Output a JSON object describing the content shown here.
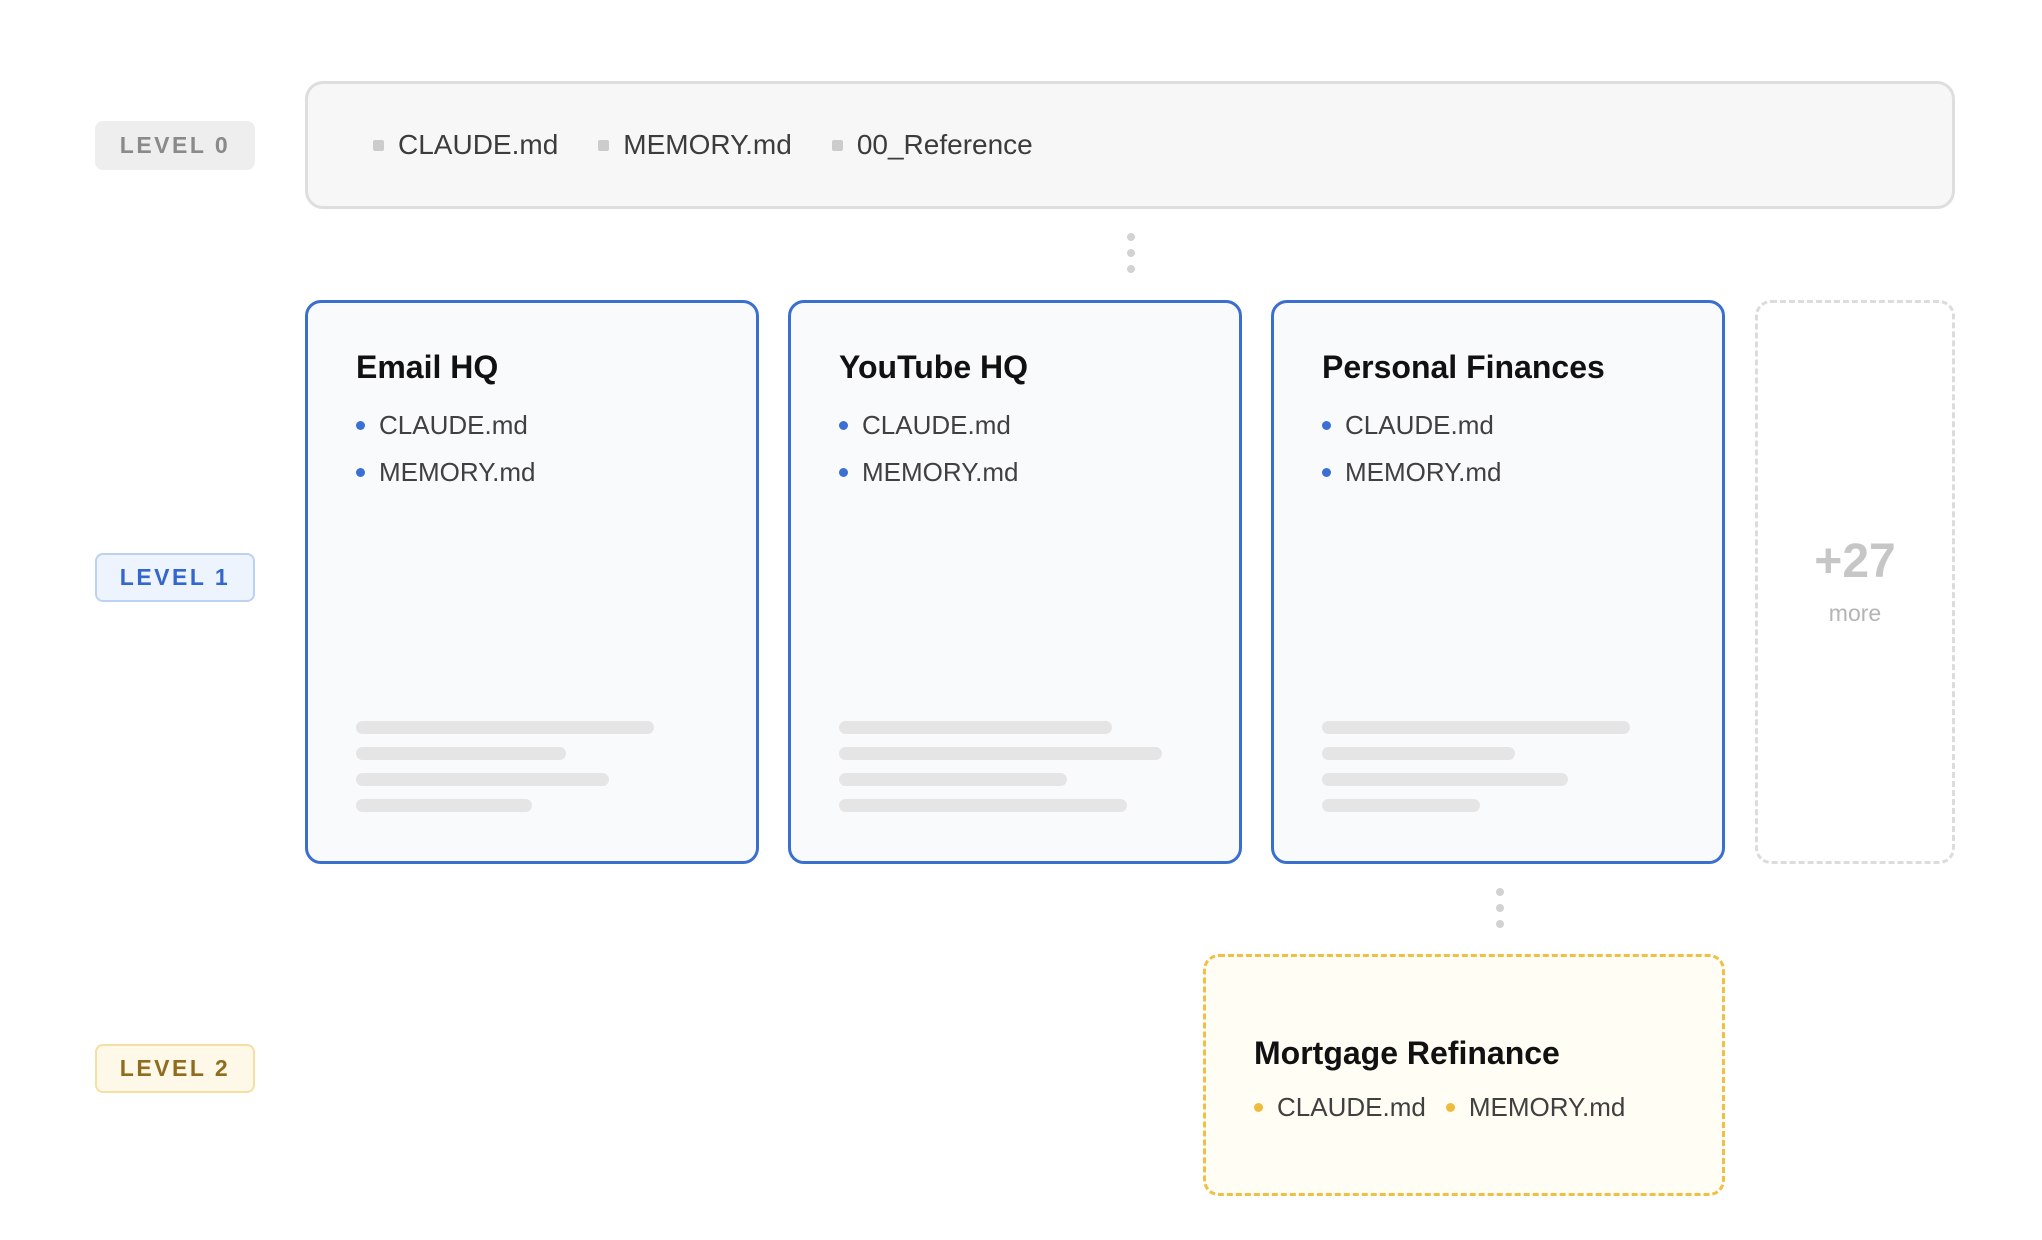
{
  "levels": {
    "level0": {
      "badge": "LEVEL 0",
      "items": [
        "CLAUDE.md",
        "MEMORY.md",
        "00_Reference"
      ]
    },
    "level1": {
      "badge": "LEVEL 1",
      "cards": [
        {
          "title": "Email HQ",
          "files": [
            "CLAUDE.md",
            "MEMORY.md"
          ]
        },
        {
          "title": "YouTube HQ",
          "files": [
            "CLAUDE.md",
            "MEMORY.md"
          ]
        },
        {
          "title": "Personal Finances",
          "files": [
            "CLAUDE.md",
            "MEMORY.md"
          ]
        }
      ],
      "more": {
        "count": "+27",
        "label": "more"
      }
    },
    "level2": {
      "badge": "LEVEL 2",
      "card": {
        "title": "Mortgage Refinance",
        "files": [
          "CLAUDE.md",
          "MEMORY.md"
        ]
      }
    }
  },
  "colors": {
    "level0_badge_bg": "#eeeeee",
    "level1_accent": "#3a6fd0",
    "level2_accent": "#f0bf45",
    "skeleton": "#e5e5e5"
  }
}
